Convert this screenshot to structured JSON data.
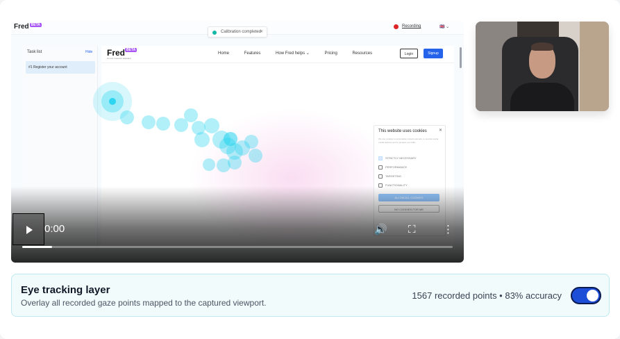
{
  "video": {
    "app_logo": "Fred",
    "app_logo_badge": "BETA",
    "toast_text": "Calibration completed",
    "toast_close": "✕",
    "recording_label": "Recording",
    "lang_flag": "🇬🇧 ⌄",
    "sidebar": {
      "title": "Task list",
      "hide_label": "Hide",
      "task": "#1 Register your account"
    },
    "site": {
      "logo": "Fred",
      "logo_badge": "BETA",
      "tagline": "AI user research assistant",
      "nav": [
        "Home",
        "Features",
        "How Fred helps ⌄",
        "Pricing",
        "Resources"
      ],
      "login": "Login",
      "signup": "Signup"
    },
    "cookie": {
      "title": "This website uses cookies",
      "close": "✕",
      "text": "We use cookies to personalise content and ads, to provide social media features and to analyse our traffic.",
      "options": [
        {
          "label": "STRICTLY NECESSARY",
          "checked": true
        },
        {
          "label": "PERFORMANCE",
          "checked": false
        },
        {
          "label": "TARGETING",
          "checked": false
        },
        {
          "label": "FUNCTIONALITY",
          "checked": false
        }
      ],
      "allow": "ALLOW ALL COOKIES",
      "decline": "NO COOKIES FOR ME"
    },
    "controls": {
      "time": "0:00",
      "volume_icon": "🔊",
      "fullscreen_icon": "⛶",
      "menu_icon": "⋮",
      "progress": 0.07
    }
  },
  "panel": {
    "title": "Eye tracking layer",
    "subtitle": "Overlay all recorded gaze points mapped to the captured viewport.",
    "stats": "1567 recorded points • 83% accuracy",
    "toggle_on": true
  }
}
